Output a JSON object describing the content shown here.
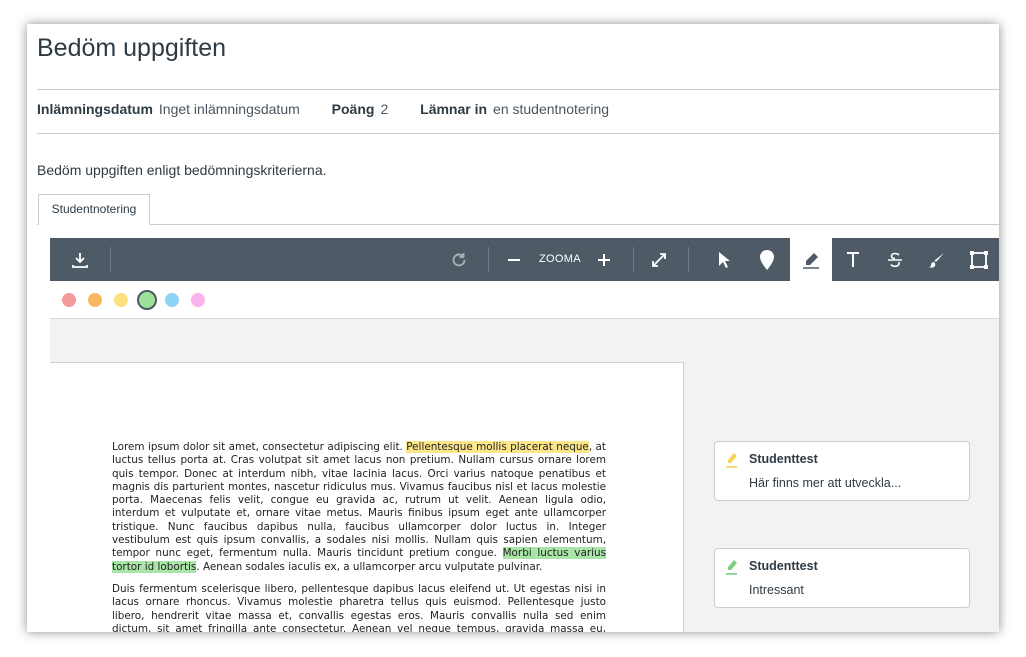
{
  "title": "Bedöm uppgiften",
  "meta": {
    "date_label": "Inlämningsdatum",
    "date_value": "Inget inlämningsdatum",
    "points_label": "Poäng",
    "points_value": "2",
    "submitting_label": "Lämnar in",
    "submitting_value": "en studentnotering"
  },
  "description": "Bedöm uppgiften enligt bedömningskriterierna.",
  "tab_label": "Studentnotering",
  "toolbar": {
    "zoom_label": "ZOOMA",
    "active_tool": "highlight"
  },
  "palette": {
    "colors": [
      "#f49a9a",
      "#f7b95e",
      "#fbe27c",
      "#9fe09a",
      "#8dd3f4",
      "#f8b3ec"
    ],
    "selected_index": 3
  },
  "document": {
    "p1_a": "Lorem ipsum dolor sit amet, consectetur adipiscing elit. ",
    "p1_hl1": "Pellentesque mollis placerat neque",
    "p1_b": ", at luctus tellus porta at. Cras volutpat sit amet lacus non pretium. Nullam cursus ornare lorem quis tempor. Donec at interdum nibh, vitae lacinia lacus. Orci varius natoque penatibus et magnis dis parturient montes, nascetur ridiculus mus. Vivamus faucibus nisl et lacus molestie porta. Maecenas felis velit, congue eu gravida ac, rutrum ut velit. Aenean ligula odio, interdum et vulputate et, ornare vitae metus. Mauris finibus ipsum eget ante ullamcorper tristique. Nunc faucibus dapibus nulla, faucibus ullamcorper dolor luctus in. Integer vestibulum est quis ipsum convallis, a sodales nisi mollis. Nullam quis sapien elementum, tempor nunc eget, fermentum nulla. Mauris tincidunt pretium congue. ",
    "p1_hl2": "Morbi luctus varius tortor id lobortis",
    "p1_c": ". Aenean sodales iaculis ex, a ullamcorper arcu vulputate pulvinar.",
    "p2": "Duis fermentum scelerisque libero, pellentesque dapibus lacus eleifend ut. Ut egestas nisi in lacus ornare rhoncus. Vivamus molestie pharetra tellus quis euismod. Pellentesque justo libero, hendrerit vitae massa et, convallis egestas eros. Mauris convallis nulla sed enim dictum, sit amet fringilla ante consectetur. Aenean vel neque tempus, gravida massa eu, condimentum turpis."
  },
  "comments": [
    {
      "author": "Studenttest",
      "text": "Här finns mer att utveckla...",
      "color": "#f3d35b"
    },
    {
      "author": "Studenttest",
      "text": "Intressant",
      "color": "#7fcf7c"
    }
  ]
}
